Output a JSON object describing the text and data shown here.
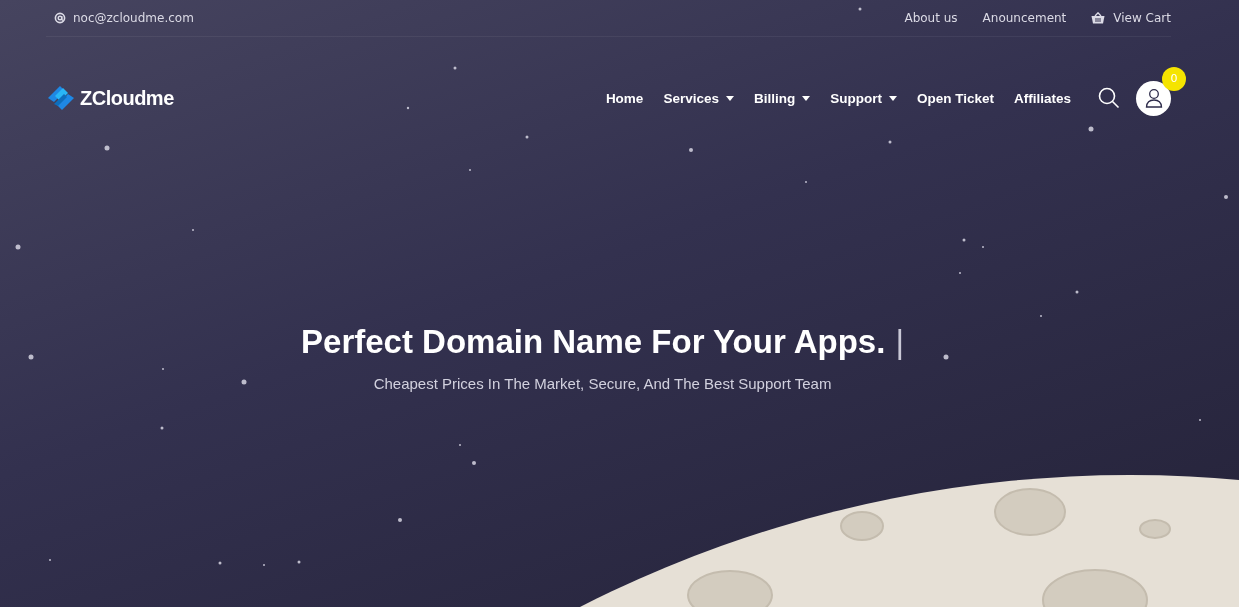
{
  "topbar": {
    "email": "noc@zcloudme.com",
    "links": [
      {
        "label": "About us",
        "kind": "link"
      },
      {
        "label": "Anouncement",
        "kind": "link"
      },
      {
        "label": "View Cart",
        "kind": "cart"
      }
    ]
  },
  "brand": {
    "name": "ZCloudme"
  },
  "nav": [
    {
      "label": "Home",
      "dropdown": false
    },
    {
      "label": "Services",
      "dropdown": true
    },
    {
      "label": "Billing",
      "dropdown": true
    },
    {
      "label": "Support",
      "dropdown": true
    },
    {
      "label": "Open Ticket",
      "dropdown": false
    },
    {
      "label": "Affiliates",
      "dropdown": false
    }
  ],
  "account": {
    "badge": "0"
  },
  "hero": {
    "title": "Perfect Domain Name For Your Apps.",
    "cursor": "|",
    "subtitle": "Cheapest Prices In The Market, Secure, And The Best Support Team"
  }
}
